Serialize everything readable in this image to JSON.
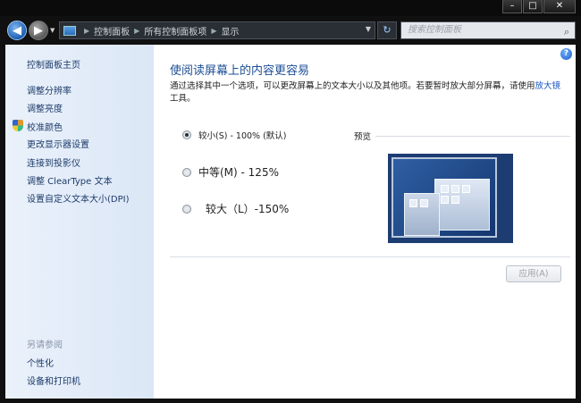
{
  "window": {
    "controls": [
      "–",
      "□",
      "✕"
    ]
  },
  "nav": {
    "back_glyph": "◀",
    "forward_glyph": "▶",
    "history_glyph": "▼",
    "breadcrumb": [
      "控制面板",
      "所有控制面板项",
      "显示"
    ],
    "separator": "▶",
    "dropdown_glyph": "▼",
    "refresh_glyph": "↻",
    "search_placeholder": "搜索控制面板",
    "icons": {
      "back": "back-arrow-icon",
      "forward": "forward-arrow-icon",
      "refresh": "refresh-icon",
      "search": "search-icon"
    }
  },
  "sidebar": {
    "home": "控制面板主页",
    "items": [
      "调整分辨率",
      "调整亮度",
      "校准颜色",
      "更改显示器设置",
      "连接到投影仪",
      "调整 ClearType 文本",
      "设置自定义文本大小(DPI)"
    ],
    "see_also_title": "另请参阅",
    "see_also": [
      "个性化",
      "设备和打印机"
    ]
  },
  "main": {
    "help": "?",
    "title": "使阅读屏幕上的内容更容易",
    "description": "通过选择其中一个选项，可以更改屏幕上的文本大小以及其他项。若要暂时放大部分屏幕，请使用",
    "description_link": "放大镜",
    "description_end": "工具。",
    "options": [
      {
        "label": "较小(S) - 100% (默认)",
        "checked": true
      },
      {
        "label": "中等(M) - 125%",
        "checked": false
      },
      {
        "label": "较大（L）-150%",
        "checked": false
      }
    ],
    "preview_label": "预览",
    "apply_button": "应用(A)"
  },
  "colors": {
    "sidebar_link": "#1d3b69",
    "title": "#1d4f95",
    "link": "#1a56c2"
  }
}
